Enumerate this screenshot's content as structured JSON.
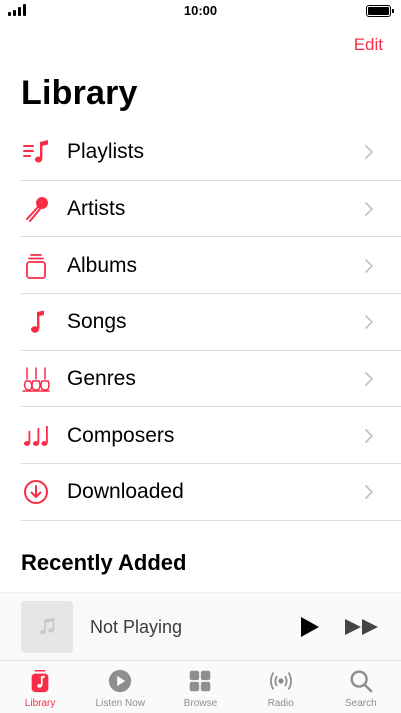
{
  "status_bar": {
    "time": "10:00"
  },
  "header": {
    "edit_label": "Edit",
    "title": "Library"
  },
  "library_items": [
    {
      "label": "Playlists",
      "icon": "playlist-icon"
    },
    {
      "label": "Artists",
      "icon": "microphone-icon"
    },
    {
      "label": "Albums",
      "icon": "album-stack-icon"
    },
    {
      "label": "Songs",
      "icon": "music-note-icon"
    },
    {
      "label": "Genres",
      "icon": "guitars-icon"
    },
    {
      "label": "Composers",
      "icon": "music-notes-icon"
    },
    {
      "label": "Downloaded",
      "icon": "download-circle-icon"
    }
  ],
  "recently_added": {
    "title": "Recently Added"
  },
  "mini_player": {
    "title": "Not Playing"
  },
  "tab_bar": {
    "tabs": [
      {
        "label": "Library",
        "icon": "library-icon",
        "active": true
      },
      {
        "label": "Listen Now",
        "icon": "play-circle-icon",
        "active": false
      },
      {
        "label": "Browse",
        "icon": "grid-icon",
        "active": false
      },
      {
        "label": "Radio",
        "icon": "radio-waves-icon",
        "active": false
      },
      {
        "label": "Search",
        "icon": "search-icon",
        "active": false
      }
    ]
  },
  "colors": {
    "accent": "#fa2d48",
    "inactive": "#8e8e8e",
    "separator": "#dcdcdc"
  }
}
